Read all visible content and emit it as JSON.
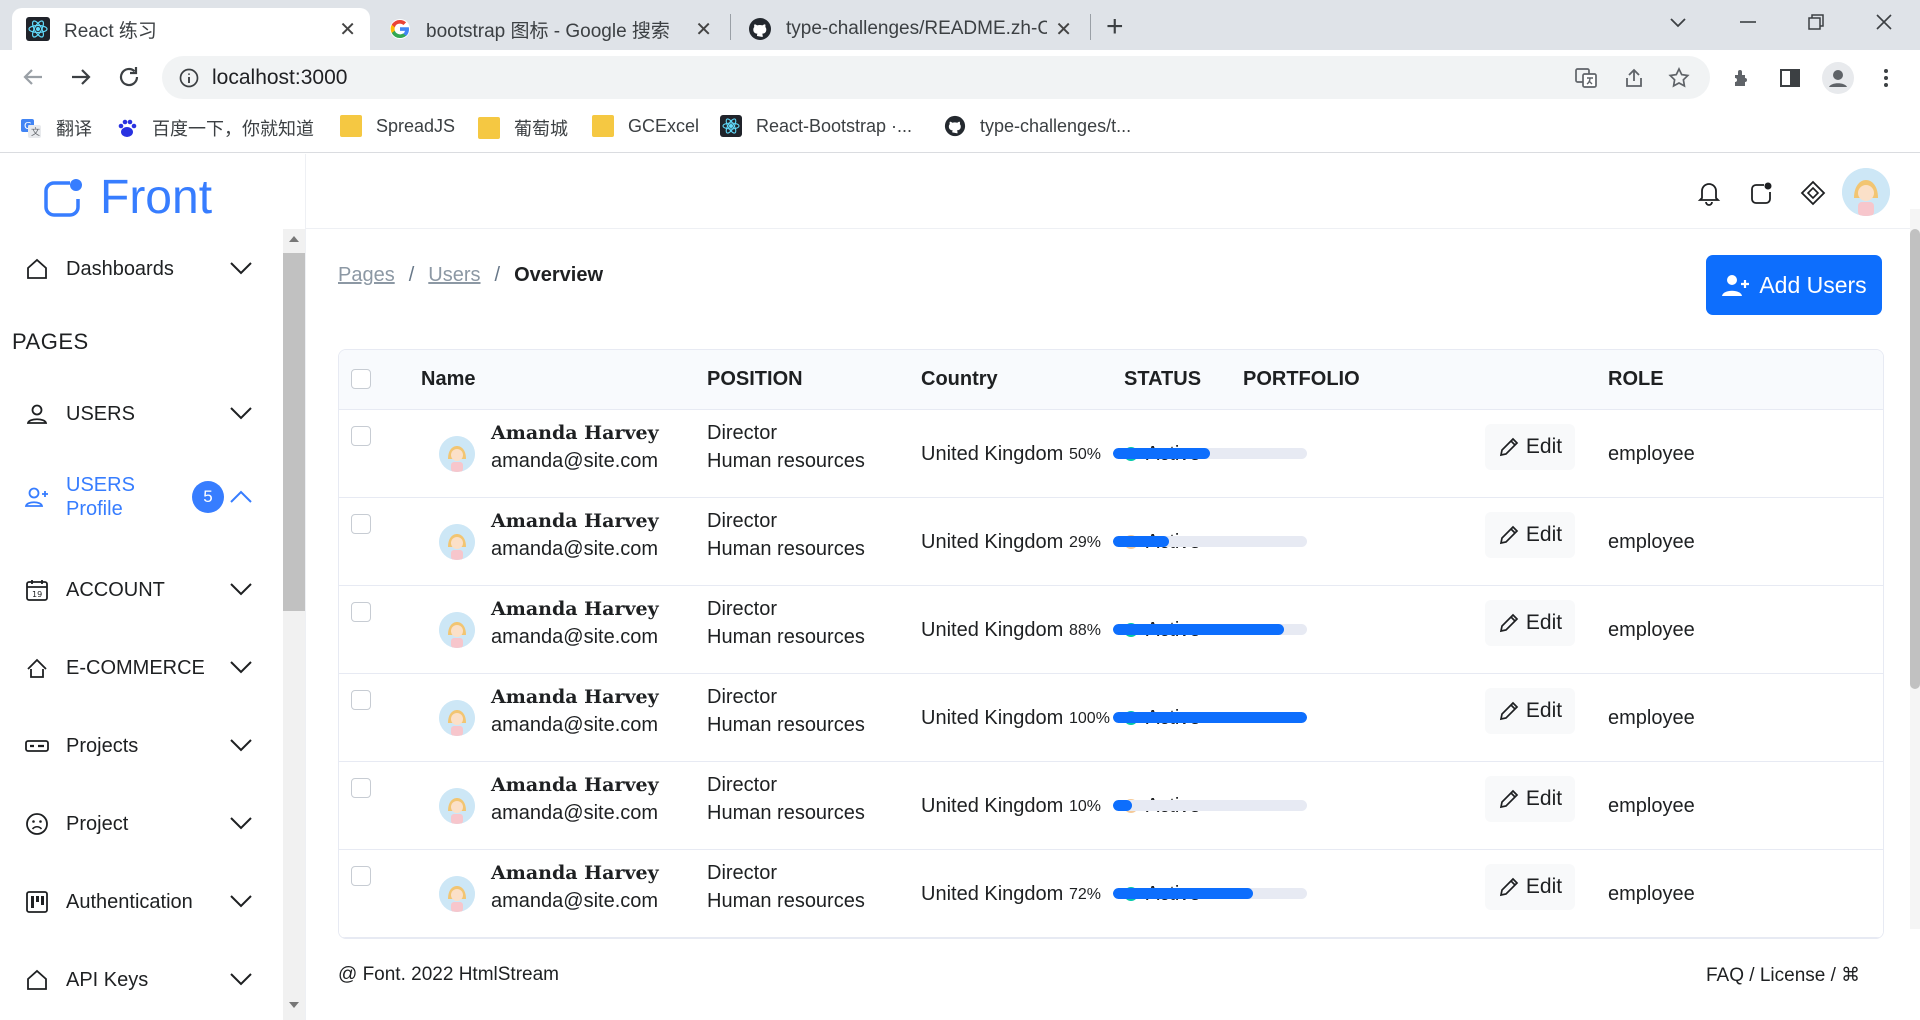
{
  "browser": {
    "tabs": [
      {
        "title": "React 练习",
        "active": true
      },
      {
        "title": "bootstrap 图标 - Google 搜索",
        "active": false
      },
      {
        "title": "type-challenges/README.zh-C",
        "active": false
      }
    ],
    "url": "localhost:3000",
    "bookmarks": [
      {
        "label": "翻译",
        "icon": "translate-icon"
      },
      {
        "label": "百度一下，你就知道",
        "icon": "baidu-icon"
      },
      {
        "label": "SpreadJS",
        "icon": "folder-icon"
      },
      {
        "label": "葡萄城",
        "icon": "folder-icon"
      },
      {
        "label": "GCExcel",
        "icon": "folder-icon"
      },
      {
        "label": "React-Bootstrap ·...",
        "icon": "react-icon"
      },
      {
        "label": "type-challenges/t...",
        "icon": "github-icon"
      }
    ]
  },
  "brand": {
    "name": "Front",
    "accent": "#377dff",
    "primary": "#0d6efd"
  },
  "sidebar": {
    "section_title": "PAGES",
    "items": [
      {
        "label": "Dashboards",
        "icon": "house-icon"
      },
      {
        "label": "USERS",
        "icon": "person-icon"
      },
      {
        "label": "USERS\nProfile",
        "label_line1": "USERS",
        "label_line2": "Profile",
        "icon": "person-add-icon",
        "badge": "5",
        "active": true
      },
      {
        "label": "ACCOUNT",
        "icon": "calendar-icon"
      },
      {
        "label": "E-COMMERCE",
        "icon": "basket-icon"
      },
      {
        "label": "Projects",
        "icon": "projects-icon"
      },
      {
        "label": "Project",
        "icon": "emoji-icon"
      },
      {
        "label": "Authentication",
        "icon": "kanban-icon"
      },
      {
        "label": "API Keys",
        "icon": "house-icon"
      }
    ]
  },
  "breadcrumb": {
    "items": [
      "Pages",
      "Users"
    ],
    "current": "Overview"
  },
  "add_button": {
    "label": "Add Users"
  },
  "table": {
    "headers": [
      "Name",
      "POSITION",
      "Country",
      "STATUS",
      "PORTFOLIO",
      "ROLE"
    ],
    "rows": [
      {
        "name": "Amanda Harvey",
        "email": "amanda@site.com",
        "position": "Director",
        "department": "Human resources",
        "country": "United Kingdom",
        "status": "Active",
        "status_color": "#00c9a7",
        "portfolio_label": "50%",
        "portfolio": 50,
        "role": "employee",
        "edit": "Edit"
      },
      {
        "name": "Amanda Harvey",
        "email": "amanda@site.com",
        "position": "Director",
        "department": "Human resources",
        "country": "United Kingdom",
        "status": "Active",
        "status_color": "#f5ca99",
        "portfolio_label": "29%",
        "portfolio": 29,
        "role": "employee",
        "edit": "Edit"
      },
      {
        "name": "Amanda Harvey",
        "email": "amanda@site.com",
        "position": "Director",
        "department": "Human resources",
        "country": "United Kingdom",
        "status": "Active",
        "status_color": "#00c9a7",
        "portfolio_label": "88%",
        "portfolio": 88,
        "role": "employee",
        "edit": "Edit"
      },
      {
        "name": "Amanda Harvey",
        "email": "amanda@site.com",
        "position": "Director",
        "department": "Human resources",
        "country": "United Kingdom",
        "status": "Active",
        "status_color": "#00c9a7",
        "portfolio_label": "100%",
        "portfolio": 100,
        "role": "employee",
        "edit": "Edit"
      },
      {
        "name": "Amanda Harvey",
        "email": "amanda@site.com",
        "position": "Director",
        "department": "Human resources",
        "country": "United Kingdom",
        "status": "Active",
        "status_color": "#f5ca99",
        "portfolio_label": "10%",
        "portfolio": 10,
        "role": "employee",
        "edit": "Edit"
      },
      {
        "name": "Amanda Harvey",
        "email": "amanda@site.com",
        "position": "Director",
        "department": "Human resources",
        "country": "United Kingdom",
        "status": "Active",
        "status_color": "#00c9a7",
        "portfolio_label": "72%",
        "portfolio": 72,
        "role": "employee",
        "edit": "Edit"
      }
    ]
  },
  "footer": {
    "left": "@ Font. 2022 HtmlStream",
    "right": "FAQ / License / ⌘"
  }
}
